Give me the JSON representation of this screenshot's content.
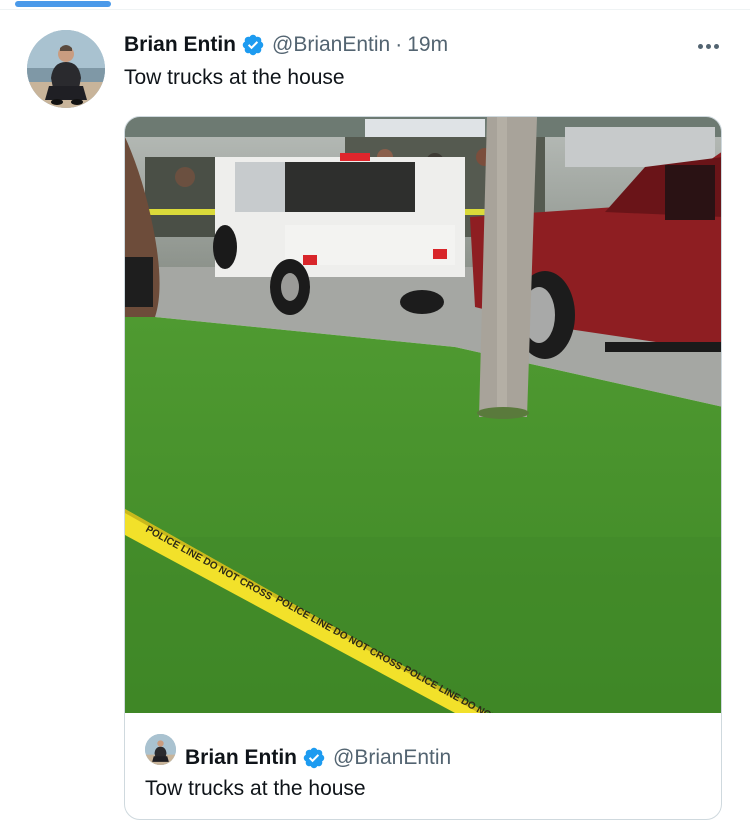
{
  "progress": {
    "value": 0.15,
    "color": "#4a99e9"
  },
  "tweet": {
    "display_name": "Brian Entin",
    "handle": "@BrianEntin",
    "separator": "·",
    "time": "19m",
    "text": "Tow trucks at the house",
    "more_icon": "more-horizontal-icon"
  },
  "quote": {
    "display_name": "Brian Entin",
    "handle": "@BrianEntin",
    "text": "Tow trucks at the house"
  },
  "colors": {
    "verified": "#1d9bf0",
    "secondary_text": "#536471",
    "primary_text": "#0f1419",
    "border": "#cfd9de"
  }
}
